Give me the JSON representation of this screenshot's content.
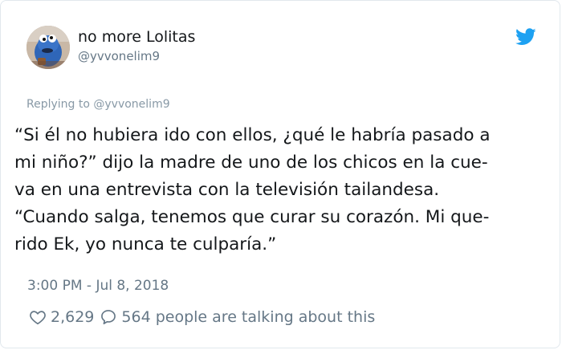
{
  "tweet": {
    "display_name": "no more Lolitas",
    "handle": "@yvvonelim9",
    "replying_to": "Replying to @yvvonelim9",
    "text_lines": [
      "“Si él no hubiera ido con ellos, ¿qué le habría pasado a",
      "mi niño?” dijo la madre de uno de los chicos en la cue-",
      "va en una entrevista con la televisión tailandesa.",
      "“Cuando salga, tenemos que curar su corazón. Mi que-",
      "rido Ek, yo nunca te culparía.”"
    ],
    "timestamp": "3:00 PM - Jul 8, 2018",
    "likes": "2,629",
    "talking": "564 people are talking about this"
  },
  "colors": {
    "brand_blue": "#1da1f2",
    "text_primary": "#14171a",
    "text_secondary": "#657786"
  },
  "icons": {
    "brand": "twitter-bird-icon",
    "like": "heart-outline-icon",
    "reply": "speech-bubble-icon"
  }
}
